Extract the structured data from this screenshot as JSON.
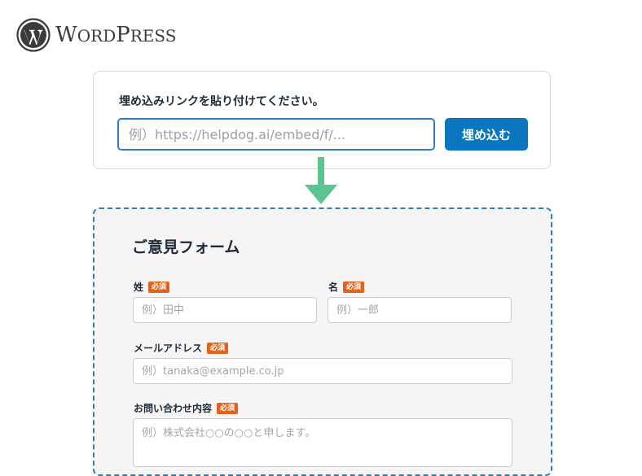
{
  "brand": {
    "name_prefix": "W",
    "name_rest": "ORD",
    "name_p": "P",
    "name_tail": "RESS"
  },
  "embed": {
    "title": "埋め込みリンクを貼り付けてください。",
    "placeholder": "例）https://helpdog.ai/embed/f/...",
    "button_label": "埋め込む"
  },
  "form": {
    "title": "ご意見フォーム",
    "required_badge": "必須",
    "fields": {
      "last_name": {
        "label": "姓",
        "placeholder": "例）田中"
      },
      "first_name": {
        "label": "名",
        "placeholder": "例）一郎"
      },
      "email": {
        "label": "メールアドレス",
        "placeholder": "例）tanaka@example.co.jp"
      },
      "message": {
        "label": "お問い合わせ内容",
        "placeholder": "例）株式会社○○の○○と申します。"
      }
    }
  },
  "colors": {
    "primary_button": "#0a76bf",
    "input_focus_border": "#2f79c9",
    "arrow": "#5bc48f",
    "dashed_border": "#2b7fb8",
    "badge": "#e0641b"
  },
  "icons": {
    "logo": "wordpress-logo-icon",
    "flow": "arrow-down-icon"
  }
}
